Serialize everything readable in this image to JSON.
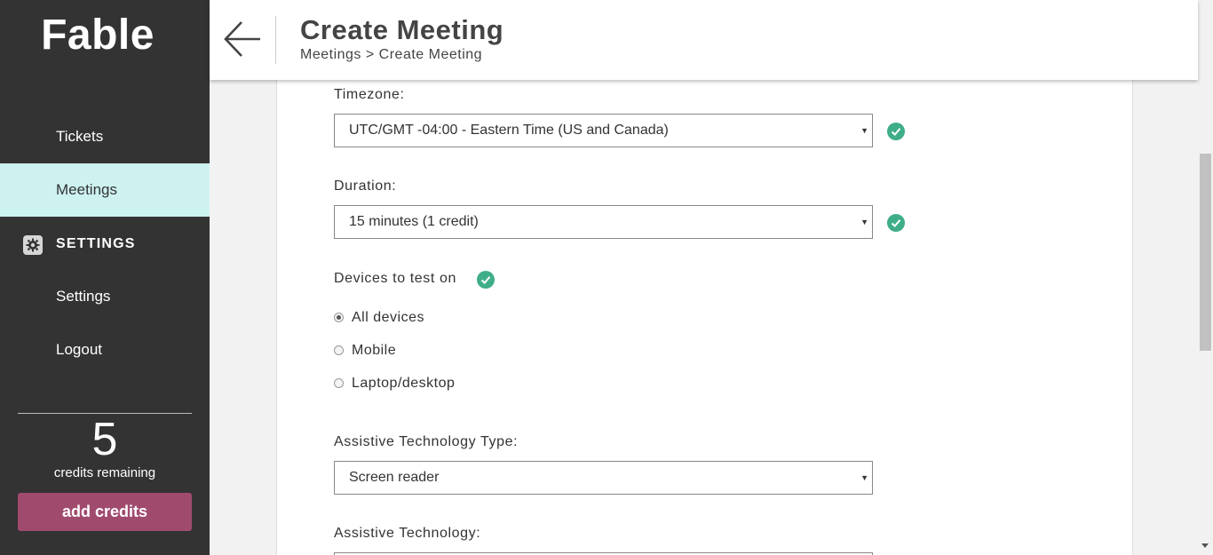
{
  "sidebar": {
    "logo": "Fable",
    "items": [
      {
        "label": "Tickets"
      },
      {
        "label": "Meetings",
        "active": true
      }
    ],
    "section_title": "SETTINGS",
    "section_items": [
      {
        "label": "Settings"
      },
      {
        "label": "Logout"
      }
    ],
    "credits": {
      "count": "5",
      "label": "credits remaining"
    },
    "add_credits_label": "add credits"
  },
  "header": {
    "title": "Create Meeting",
    "breadcrumb": "Meetings > Create Meeting",
    "back_icon": "arrow-left-icon"
  },
  "form": {
    "timezone": {
      "label": "Timezone:",
      "value": "UTC/GMT -04:00 - Eastern Time (US and Canada)"
    },
    "duration": {
      "label": "Duration:",
      "value": "15 minutes (1 credit)"
    },
    "devices": {
      "label": "Devices to test on",
      "options": [
        {
          "label": "All devices",
          "checked": true
        },
        {
          "label": "Mobile",
          "checked": false
        },
        {
          "label": "Laptop/desktop",
          "checked": false
        }
      ]
    },
    "at_type": {
      "label": "Assistive Technology Type:",
      "value": "Screen reader"
    },
    "at": {
      "label": "Assistive Technology:"
    }
  },
  "colors": {
    "sidebar_bg": "#333333",
    "active_bg": "#cdf2f0",
    "accent_button": "#a04b6e",
    "check_green": "#3fae88"
  }
}
